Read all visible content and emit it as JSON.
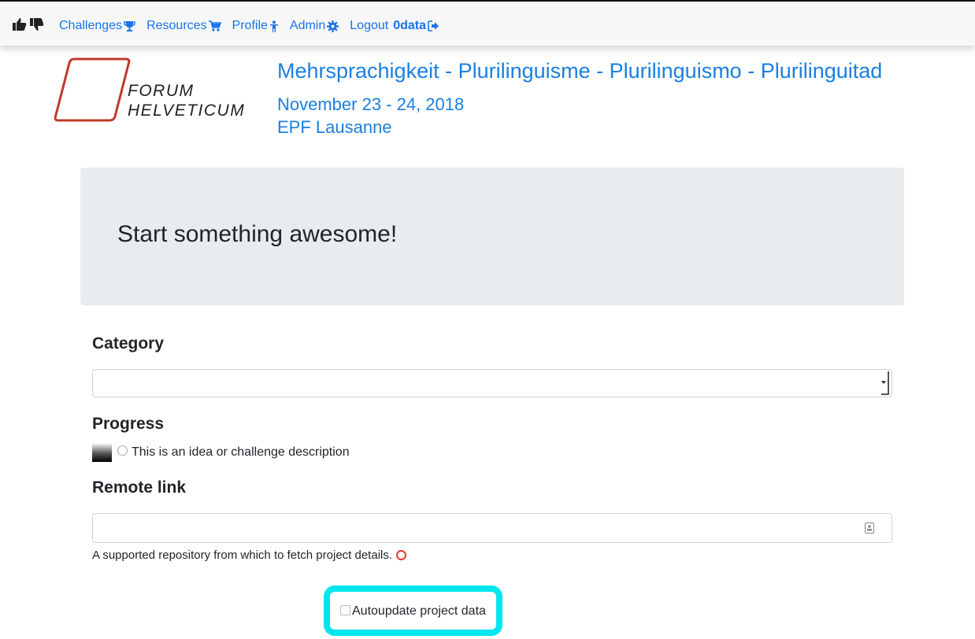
{
  "nav": {
    "brand_icons": [
      "thumbs-up-icon",
      "thumbs-down-icon"
    ],
    "items": [
      {
        "label": "Challenges",
        "icon": "trophy-icon"
      },
      {
        "label": "Resources",
        "icon": "cart-icon"
      },
      {
        "label": "Profile",
        "icon": "person-icon"
      },
      {
        "label": "Admin",
        "icon": "gear-icon"
      }
    ],
    "logout": {
      "label": "Logout",
      "user": "0data",
      "icon": "sign-out-icon"
    }
  },
  "header": {
    "logo_line1": "FORUM",
    "logo_line2": "HELVETICUM",
    "title": "Mehrsprachigkeit - Plurilinguisme - Plurilinguismo - Plurilinguitad",
    "date": "November 23 - 24, 2018",
    "venue": "EPF Lausanne"
  },
  "jumbotron": {
    "heading": "Start something awesome!"
  },
  "form": {
    "category_label": "Category",
    "category_value": "",
    "progress_label": "Progress",
    "progress_option": "This is an idea or challenge description",
    "remote_link_label": "Remote link",
    "remote_link_value": "",
    "remote_link_help": "A supported repository from which to fetch project details.",
    "autoupdate_label": "Autoupdate project data",
    "autoupdate_checked": false
  },
  "colors": {
    "accent": "#1a7fe0",
    "highlight": "#00e5ee",
    "jumbotron_bg": "#e9ecef",
    "warning_ring": "#e53935"
  }
}
